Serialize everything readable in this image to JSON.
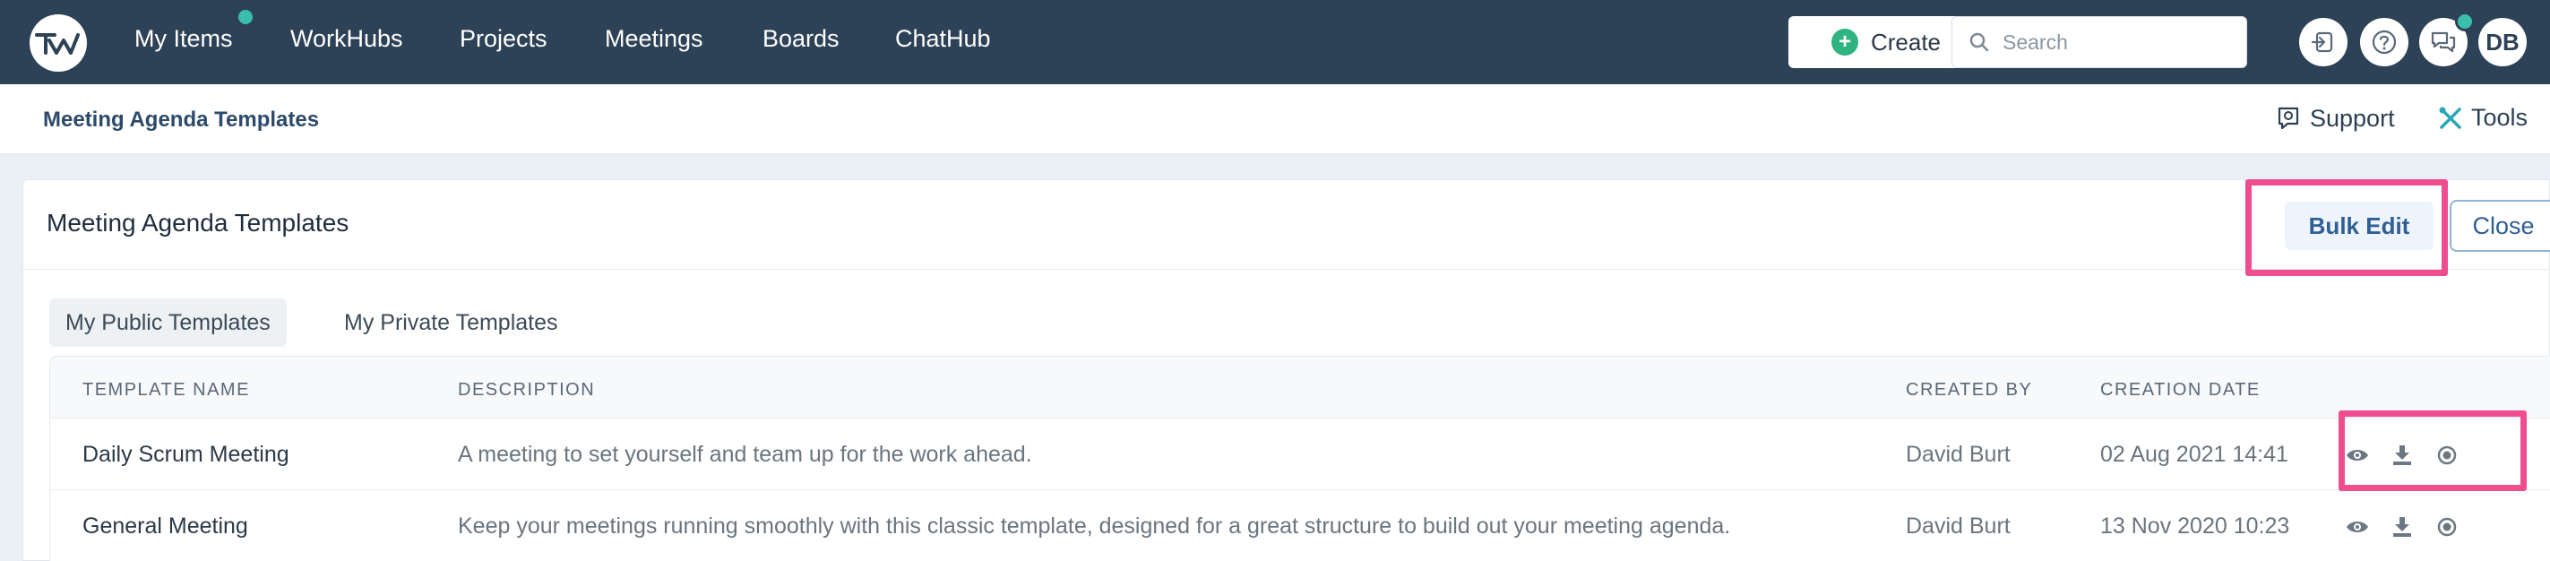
{
  "nav": {
    "items": [
      "My Items",
      "WorkHubs",
      "Projects",
      "Meetings",
      "Boards",
      "ChatHub"
    ],
    "create_label": "Create",
    "search_placeholder": "Search",
    "avatar_initials": "DB",
    "accent": "#3bbfad",
    "bar_color": "#2d4257"
  },
  "subheader": {
    "breadcrumb": "Meeting Agenda Templates",
    "support_label": "Support",
    "tools_label": "Tools"
  },
  "panel": {
    "title": "Meeting Agenda Templates",
    "bulk_edit_label": "Bulk Edit",
    "close_label": "Close",
    "highlight_color": "#ee4d8f",
    "tabs": [
      {
        "label": "My Public Templates",
        "active": true
      },
      {
        "label": "My Private Templates",
        "active": false
      }
    ]
  },
  "table": {
    "columns": [
      "TEMPLATE NAME",
      "DESCRIPTION",
      "CREATED BY",
      "CREATION DATE"
    ],
    "rows": [
      {
        "name": "Daily Scrum Meeting",
        "description": "A meeting to set yourself and team up for the work ahead.",
        "created_by": "David Burt",
        "created_date": "02 Aug 2021 14:41",
        "actions": [
          "eye-icon",
          "download-icon",
          "cancel-icon"
        ]
      },
      {
        "name": "General Meeting",
        "description": "Keep your meetings running smoothly with this classic template, designed for a great structure to build out your meeting agenda.",
        "created_by": "David Burt",
        "created_date": "13 Nov 2020 10:23",
        "actions": [
          "eye-icon",
          "download-icon",
          "cancel-icon"
        ]
      }
    ]
  }
}
